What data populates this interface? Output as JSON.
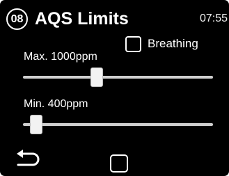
{
  "header": {
    "page_number": "08",
    "title": "AQS Limits",
    "time": "07:55"
  },
  "breathing": {
    "label": "Breathing",
    "checked": false
  },
  "sliders": {
    "max": {
      "label": "Max. 1000ppm",
      "level_fraction": 0.38
    },
    "min": {
      "label": "Min. 400ppm",
      "level_fraction": 0.04
    }
  },
  "footer": {
    "back_icon": "return-arrow-icon",
    "confirm_checked": false
  },
  "colors": {
    "background": "#000000",
    "foreground": "#ffffff",
    "track": "#cfcfcf"
  }
}
